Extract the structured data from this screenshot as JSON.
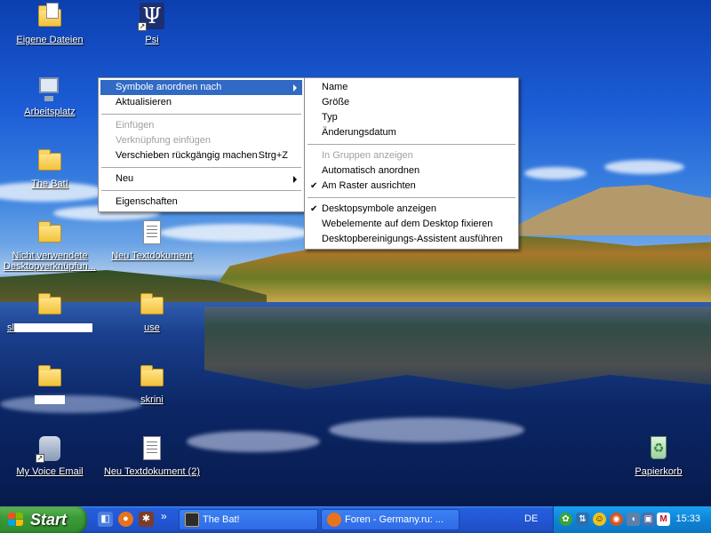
{
  "desktop": {
    "icons": [
      {
        "id": "eigene",
        "label": "Eigene Dateien",
        "icon": "my-documents-icon"
      },
      {
        "id": "psi",
        "label": "Psi",
        "icon": "psi-icon"
      },
      {
        "id": "arbeitsplatz",
        "label": "Arbeitsplatz",
        "icon": "my-computer-icon"
      },
      {
        "id": "thebat",
        "label": "The Bat!",
        "icon": "folder-icon"
      },
      {
        "id": "unused",
        "label": "Nicht verwendete Desktopverknüpfun...",
        "label_line1": "Nicht verwendete",
        "label_line2": "Desktopverknüpfun...",
        "icon": "folder-icon"
      },
      {
        "id": "textdoc1",
        "label": "Neu Textdokument",
        "icon": "text-document-icon"
      },
      {
        "id": "folder-si",
        "label": "sl",
        "icon": "folder-icon"
      },
      {
        "id": "use",
        "label": "use",
        "icon": "folder-icon"
      },
      {
        "id": "folder-redacted",
        "label": "",
        "icon": "folder-icon"
      },
      {
        "id": "skrini",
        "label": "skrini",
        "icon": "folder-icon"
      },
      {
        "id": "voice",
        "label": "My Voice Email",
        "icon": "voice-email-icon"
      },
      {
        "id": "textdoc2",
        "label": "Neu Textdokument (2)",
        "icon": "text-document-icon"
      },
      {
        "id": "papierkorb",
        "label": "Papierkorb",
        "icon": "recycle-bin-icon"
      }
    ]
  },
  "context_menu": {
    "items": [
      {
        "label": "Symbole anordnen nach",
        "submenu": true,
        "highlighted": true
      },
      {
        "label": "Aktualisieren"
      },
      {
        "label": "Einfügen",
        "disabled": true
      },
      {
        "label": "Verknüpfung einfügen",
        "disabled": true
      },
      {
        "label": "Verschieben rückgängig machen",
        "shortcut": "Strg+Z"
      },
      {
        "label": "Neu",
        "submenu": true
      },
      {
        "label": "Eigenschaften"
      }
    ]
  },
  "submenu": {
    "items": [
      {
        "label": "Name"
      },
      {
        "label": "Größe"
      },
      {
        "label": "Typ"
      },
      {
        "label": "Änderungsdatum"
      },
      {
        "label": "In Gruppen anzeigen",
        "disabled": true
      },
      {
        "label": "Automatisch anordnen"
      },
      {
        "label": "Am Raster ausrichten",
        "checked": true
      },
      {
        "label": "Desktopsymbole anzeigen",
        "checked": true
      },
      {
        "label": "Webelemente auf dem Desktop fixieren"
      },
      {
        "label": "Desktopbereinigungs-Assistent ausführen"
      }
    ]
  },
  "taskbar": {
    "start_label": "Start",
    "quick_launch_icons": [
      "show-desktop-icon",
      "firefox-icon",
      "media-icon"
    ],
    "more_glyph": "»",
    "buttons": [
      {
        "label": "The Bat!",
        "icon": "the-bat-icon"
      },
      {
        "label": "Foren - Germany.ru: ...",
        "icon": "firefox-icon"
      }
    ],
    "language": "DE",
    "tray_icons": [
      "icq-icon",
      "network-icon",
      "smiley-icon",
      "antivirus-icon",
      "speaker-icon",
      "monitor-icon",
      "m-icon"
    ],
    "clock": "15:33"
  },
  "colors": {
    "menu_highlight": "#316ac5",
    "taskbar": "#245edb",
    "start_button": "#3c9b38",
    "tray": "#0f85d8"
  }
}
